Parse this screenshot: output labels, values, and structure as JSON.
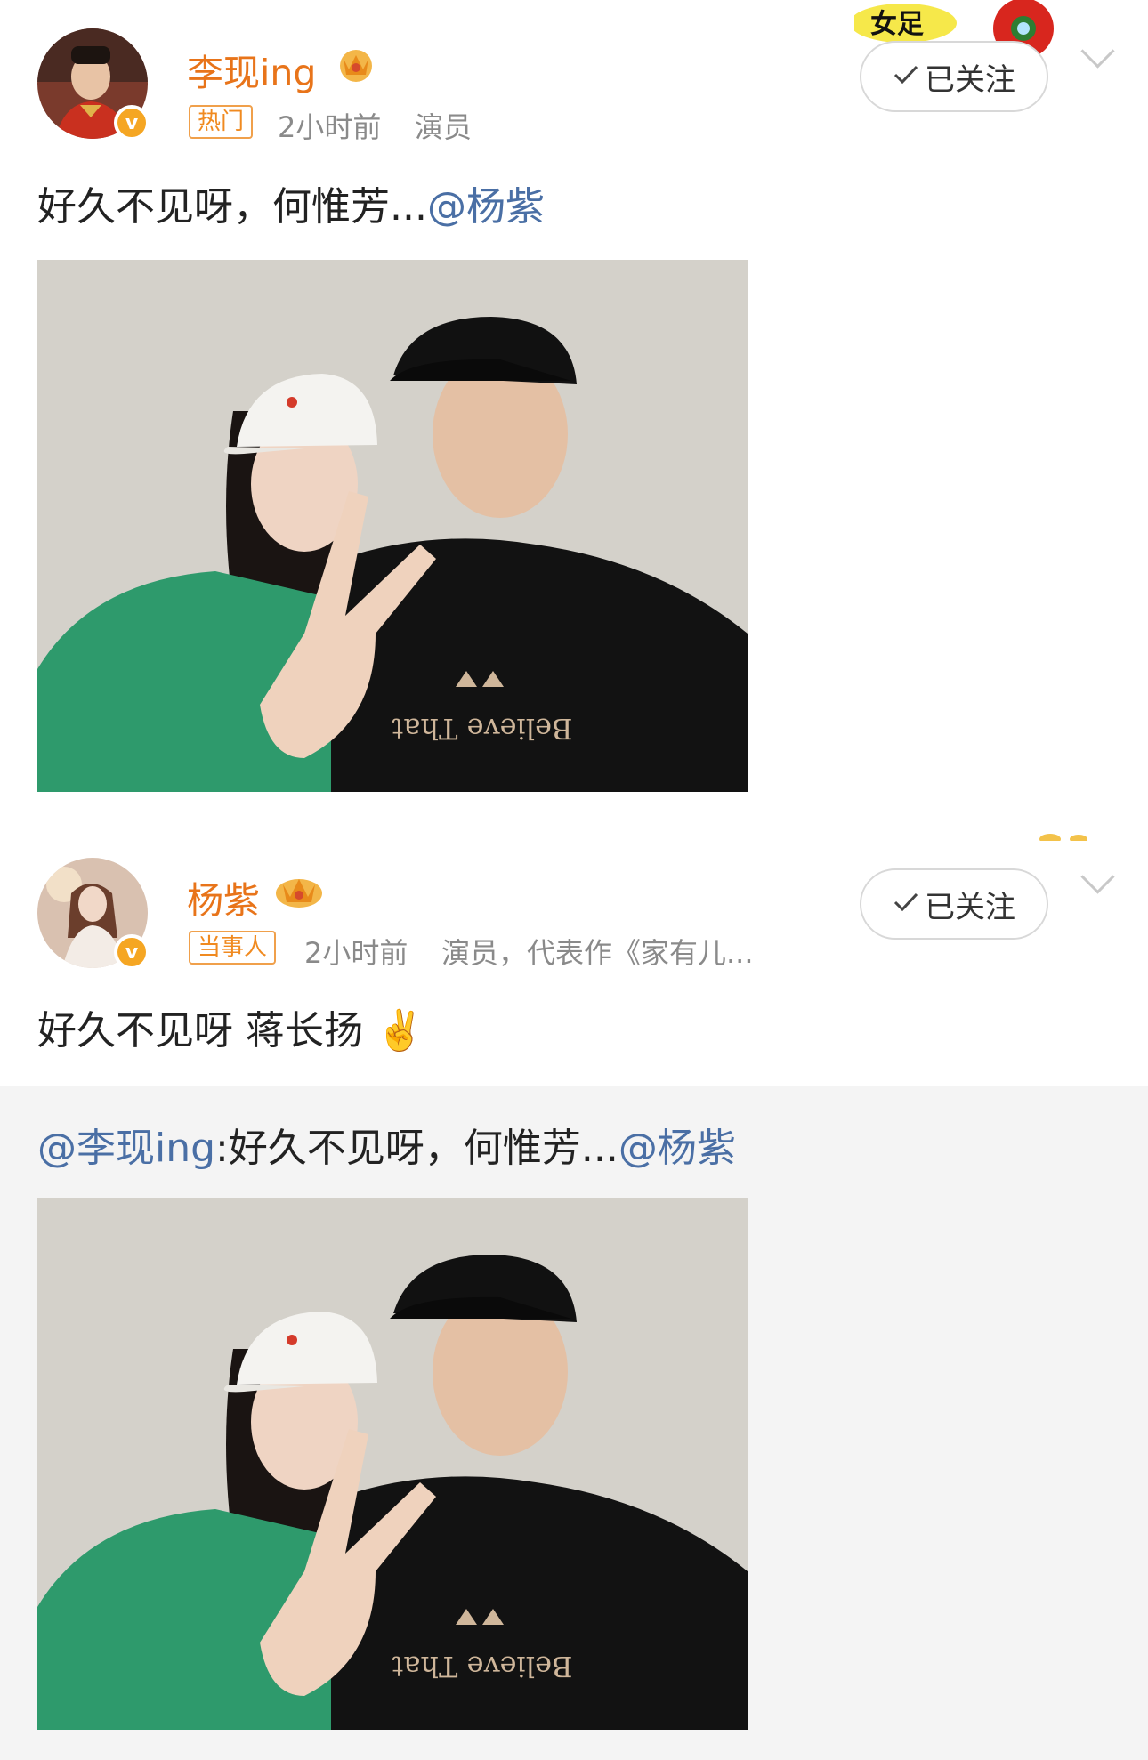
{
  "post1": {
    "username": "李现ing",
    "tag": "热门",
    "time": "2小时前",
    "description": "演员",
    "follow_label": "已关注",
    "text": "好久不见呀，何惟芳...",
    "mention": "@杨紫"
  },
  "post2": {
    "username": "杨紫",
    "tag": "当事人",
    "time": "2小时前",
    "description": "演员，代表作《家有儿...",
    "follow_label": "已关注",
    "text": "好久不见呀 蒋长扬",
    "emoji": "✌️"
  },
  "repost": {
    "author_mention": "@李现ing",
    "text": ":好久不见呀，何惟芳...",
    "mention": "@杨紫"
  },
  "photo": {
    "shirt_text": "Believe That"
  },
  "sticker": {
    "text": "女足"
  },
  "colors": {
    "username": "#e8741a",
    "mention": "#4a6fa5",
    "verified": "#f5a623",
    "repost_bg": "#f4f4f4"
  }
}
